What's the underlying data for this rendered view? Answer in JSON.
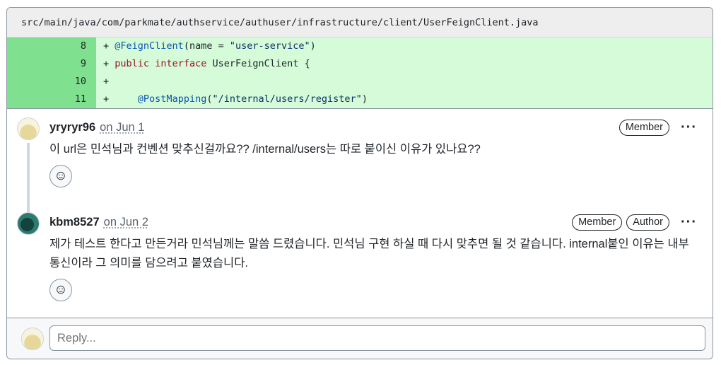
{
  "file": {
    "path": "src/main/java/com/parkmate/authservice/authuser/infrastructure/client/UserFeignClient.java"
  },
  "diff": {
    "lines": [
      {
        "num": "8",
        "prefix": "+",
        "annotation": "@FeignClient",
        "text_a": "(name = ",
        "string": "\"user-service\"",
        "text_b": ")"
      },
      {
        "num": "9",
        "prefix": "+",
        "kw1": "public",
        "kw2": "interface",
        "text": "UserFeignClient {"
      },
      {
        "num": "10",
        "prefix": "+"
      },
      {
        "num": "11",
        "prefix": "+",
        "indent": "    ",
        "annotation": "@PostMapping",
        "text_a": "(",
        "string": "\"/internal/users/register\"",
        "text_b": ")"
      }
    ]
  },
  "comments": [
    {
      "author": "yryryr96",
      "time": "on Jun 1",
      "badges": [
        "Member"
      ],
      "body": "이 url은 민석님과 컨벤션 맞추신걸까요?? /internal/users는 따로 붙이신 이유가 있나요??"
    },
    {
      "author": "kbm8527",
      "time": "on Jun 2",
      "badges": [
        "Member",
        "Author"
      ],
      "body": "제가 테스트 한다고 만든거라 민석님께는 말씀 드렸습니다. 민석님 구현 하실 때 다시 맞추면 될 것 같습니다. internal붙인 이유는 내부통신이라 그 의미를 담으려고 붙였습니다."
    }
  ],
  "icons": {
    "more": "kebab-horizontal-icon",
    "react": "smiley-icon"
  },
  "reply": {
    "placeholder": "Reply..."
  },
  "colors": {
    "added_line_number_bg": "#7fe08f",
    "added_code_bg": "#d5fbd9",
    "keyword": "#a0111f",
    "annotation": "#0a53b0"
  }
}
